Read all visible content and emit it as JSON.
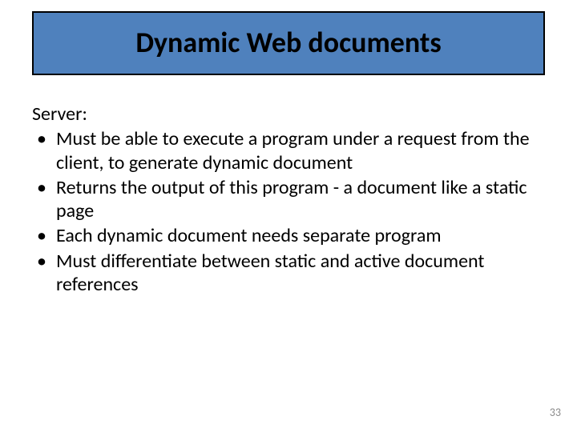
{
  "title": "Dynamic Web documents",
  "lead": "Server:",
  "bullets": [
    "Must be able to execute a program under a request from the client, to generate dynamic document",
    "Returns the output of this program - a document like a static page",
    "Each dynamic document needs separate program",
    "Must differentiate between static and active document references"
  ],
  "page_number": "33"
}
